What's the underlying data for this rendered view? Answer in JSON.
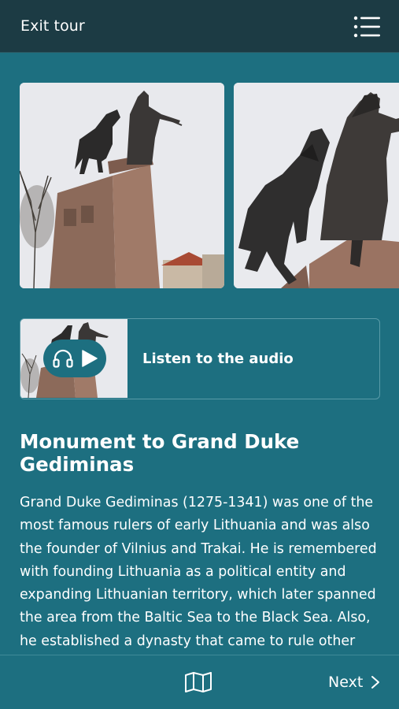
{
  "header": {
    "exit_label": "Exit tour",
    "menu_icon": "list-menu-icon"
  },
  "gallery": {
    "images": [
      {
        "alt": "statue-photo-wide",
        "icon": "photo"
      },
      {
        "alt": "statue-photo-closeup",
        "icon": "photo"
      }
    ]
  },
  "audio": {
    "label": "Listen to the audio",
    "icons": [
      "headphones-icon",
      "play-icon"
    ]
  },
  "content": {
    "title": "Monument to Grand Duke Gediminas",
    "description": "Grand Duke Gediminas (1275-1341) was one of the most famous rulers of early Lithuania and was also the founder of Vilnius and Trakai. He is remembered with founding Lithuania as a political entity and expanding Lithuanian territory, which later spanned the area from the Baltic Sea to the Black Sea. Also, he established a dynasty that came to rule other"
  },
  "footer": {
    "map_icon": "map-icon",
    "next_label": "Next"
  },
  "colors": {
    "background": "#1d6f80",
    "header": "#1c3b44",
    "text": "#ffffff",
    "card_border": "#5a9ba8"
  }
}
